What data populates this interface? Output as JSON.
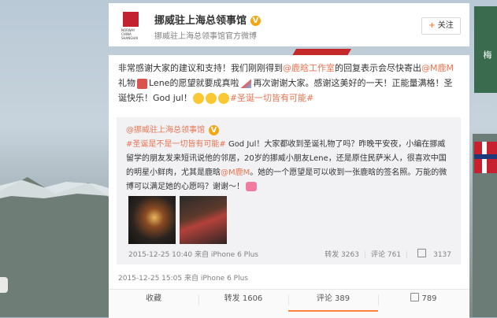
{
  "header": {
    "name": "挪威驻上海总领事馆",
    "verified_mark": "V",
    "description": "挪威驻上海总领事馆官方微博",
    "follow_label": "关注",
    "logo_text": "NORWAY CHINA SHANGHAI"
  },
  "post": {
    "text_1": "非常感谢大家的建议和支持！我们刚刚得到",
    "mention_1": "@鹿晗工作室",
    "text_2": "的回复表示会尽快寄出",
    "mention_2": "@M鹿M",
    "text_3": "礼物",
    "text_4": "Lene的愿望就要成真啦",
    "text_5": "再次谢谢大家。感谢这美好的一天！正能量满格！圣诞快乐！God jul！",
    "hashtag": "#圣诞一切皆有可能#",
    "meta": "2015-12-25 15:05 来自 iPhone 6 Plus"
  },
  "quote": {
    "author": "@挪威驻上海总领事馆",
    "verified_mark": "V",
    "hashtag": "#圣诞是不是一切皆有可能#",
    "text_1": " God Jul！大家都收到圣诞礼物了吗？昨晚平安夜，小编在挪威留学的朋友发来短讯说他的邻居，20岁的挪威小朋友Lene，还是原住民萨米人，很喜欢中国的明星小鲜肉，尤其是鹿晗",
    "mention": "@M鹿M",
    "text_2": "。她的一个愿望是可以收到一张鹿晗的签名照。万能的微博可以满足她的心愿吗？谢谢～！",
    "meta": "2015-12-25 10:40 来自 iPhone 6 Plus",
    "repost": "转发 3263",
    "comment": "评论 761",
    "like": "3137"
  },
  "actions": {
    "favorite": "收藏",
    "repost": "转发 1606",
    "comment": "评论 389",
    "like": "789"
  },
  "background": {
    "side_text": "梅"
  },
  "colors": {
    "link": "#eb7350",
    "accent": "#ff8140",
    "verified": "#f3a712"
  }
}
